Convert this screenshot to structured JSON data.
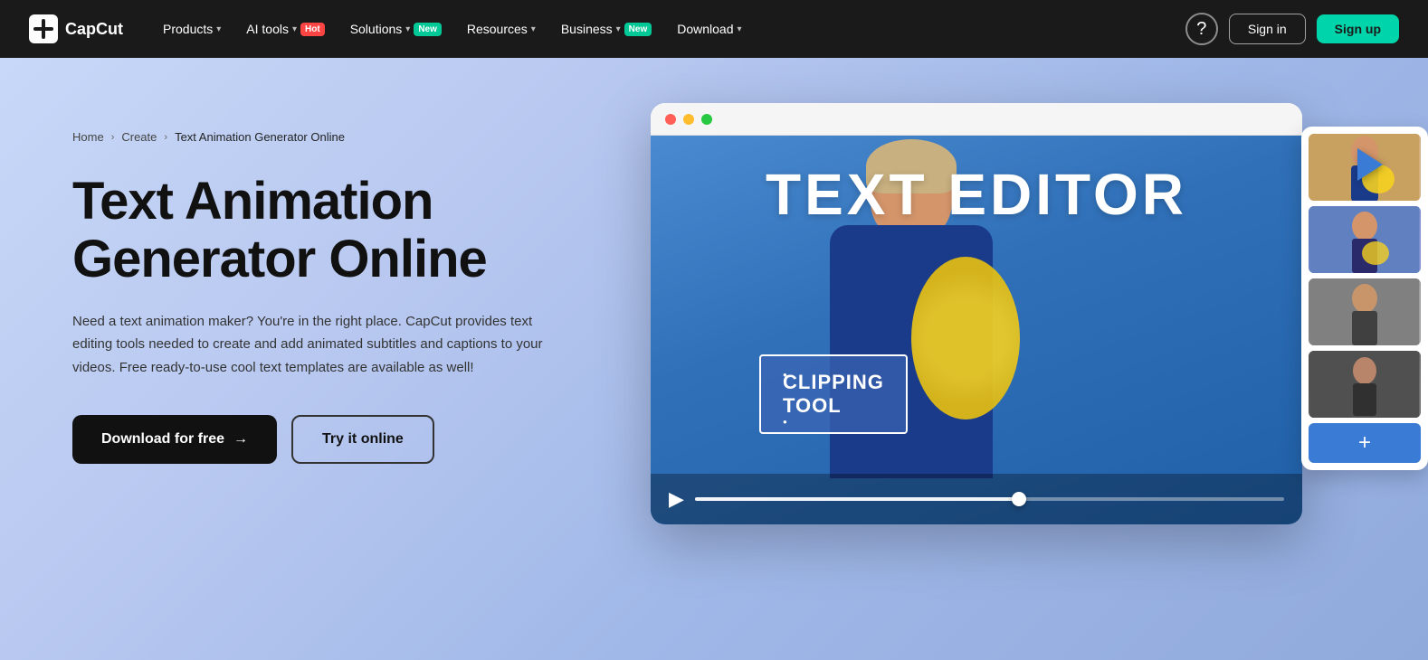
{
  "navbar": {
    "logo_text": "CapCut",
    "nav_items": [
      {
        "label": "Products",
        "has_dropdown": true,
        "badge": null
      },
      {
        "label": "AI tools",
        "has_dropdown": true,
        "badge": {
          "text": "Hot",
          "type": "hot"
        }
      },
      {
        "label": "Solutions",
        "has_dropdown": true,
        "badge": {
          "text": "New",
          "type": "new"
        }
      },
      {
        "label": "Resources",
        "has_dropdown": true,
        "badge": null
      },
      {
        "label": "Business",
        "has_dropdown": true,
        "badge": {
          "text": "New",
          "type": "new"
        }
      },
      {
        "label": "Download",
        "has_dropdown": true,
        "badge": null
      }
    ],
    "help_icon": "?",
    "signin_label": "Sign in",
    "signup_label": "Sign up"
  },
  "breadcrumb": {
    "home": "Home",
    "create": "Create",
    "current": "Text Animation Generator Online"
  },
  "hero": {
    "title": "Text Animation Generator Online",
    "description": "Need a text animation maker? You're in the right place. CapCut provides text editing tools needed to create and add animated subtitles and captions to your videos. Free ready-to-use cool text templates are available as well!",
    "download_btn": "Download for free",
    "try_btn": "Try it online",
    "arrow_icon": "→"
  },
  "video_mockup": {
    "text_editor_label": "TEXT EDITOR",
    "clipping_label": "CLIPPING\nTOOL",
    "add_icon": "+",
    "play_icon": "▶",
    "progress_percent": 55
  },
  "colors": {
    "nav_bg": "#1a1a1a",
    "hero_bg_start": "#c8d8f8",
    "hero_bg_end": "#90aadc",
    "btn_download_bg": "#111111",
    "badge_hot_bg": "#ff4444",
    "badge_new_bg": "#00c896",
    "signup_bg": "#00d4aa",
    "video_bg": "#3a7bd5"
  }
}
